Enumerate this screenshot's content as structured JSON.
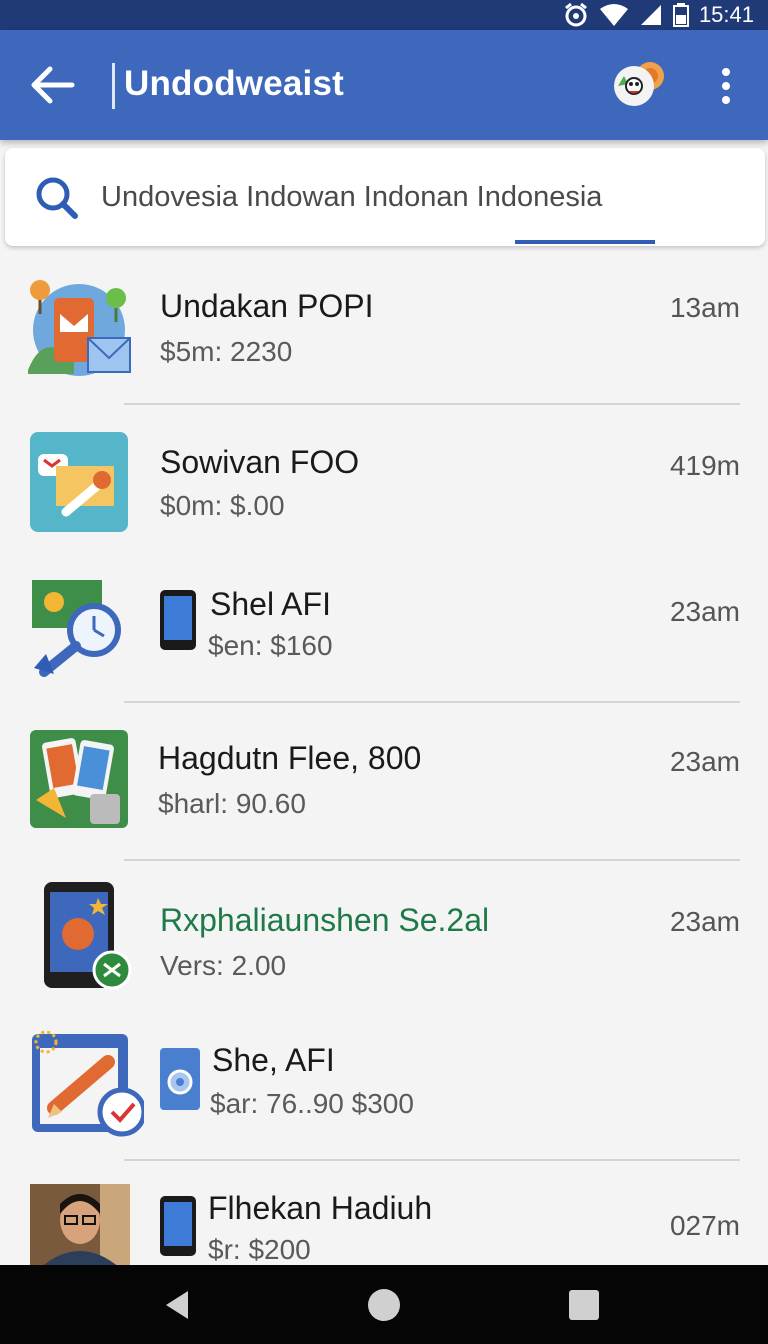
{
  "status_bar": {
    "time": "15:41"
  },
  "app_bar": {
    "title": "Undodweaist"
  },
  "search": {
    "value": "Undovesia Indowan Indonan Indonesia"
  },
  "items": [
    {
      "title": "Undakan POPI",
      "subtitle": "$5m: 2230",
      "time": "13am"
    },
    {
      "title": "Sowivan FOO",
      "subtitle": "$0m: $.00",
      "time": "419m"
    },
    {
      "title": "Shel AFI",
      "subtitle": "$en: $160",
      "time": "23am"
    },
    {
      "title": "Hagdutn Flee, 800",
      "subtitle": "$harl: 90.60",
      "time": "23am"
    },
    {
      "title": "Rxphaliaunshen Se.2al",
      "subtitle": "Vers: 2.00",
      "time": "23am",
      "title_color": "#1e7a48"
    },
    {
      "title": "She, AFI",
      "subtitle": "$ar: 76..90 $300",
      "time": ""
    },
    {
      "title": "Flhekan Hadiuh",
      "subtitle": "$r: $200",
      "time": "027m"
    }
  ],
  "colors": {
    "accent": "#3d68bb",
    "status_bar": "#203a78",
    "highlight_title": "#1e7a48"
  }
}
